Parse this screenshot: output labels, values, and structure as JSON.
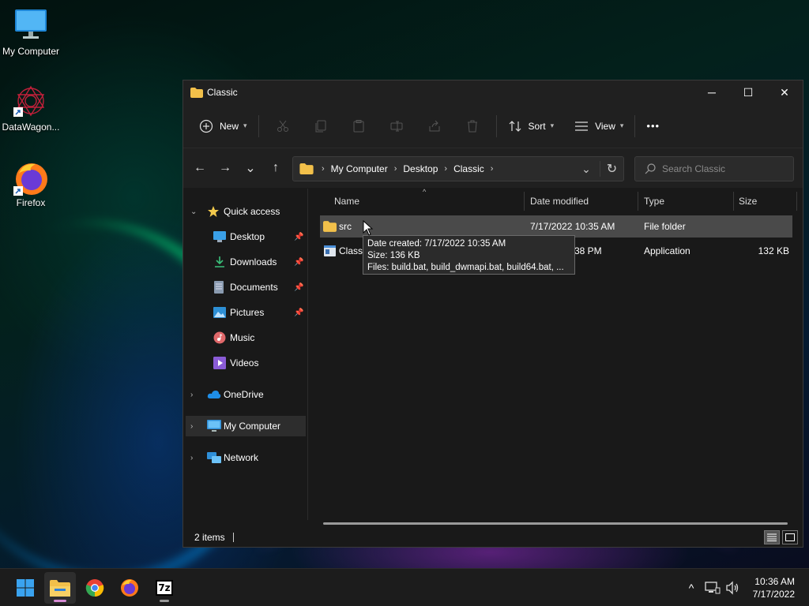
{
  "desktop": {
    "icons": [
      {
        "label": "My Computer",
        "icon": "monitor-icon"
      },
      {
        "label": "DataWagon...",
        "icon": "datawagon-icon"
      },
      {
        "label": "Firefox",
        "icon": "firefox-icon"
      }
    ]
  },
  "window": {
    "title": "Classic",
    "controls": {
      "minimize": "─",
      "maximize": "☐",
      "close": "✕"
    },
    "commandbar": {
      "new_label": "New",
      "sort_label": "Sort",
      "view_label": "View",
      "more_label": "•••",
      "disabled_icons": [
        "cut-icon",
        "copy-icon",
        "paste-icon",
        "rename-icon",
        "share-icon",
        "delete-icon"
      ]
    },
    "nav": {
      "back": "←",
      "forward": "→",
      "recent": "⌄",
      "up": "↑"
    },
    "address": {
      "crumbs": [
        "My Computer",
        "Desktop",
        "Classic"
      ],
      "refresh": "↻",
      "dropdown": "⌄"
    },
    "search": {
      "placeholder": "Search Classic"
    },
    "navpane": {
      "quick_access": "Quick access",
      "items": [
        {
          "label": "Desktop",
          "icon": "desktop-folder-icon",
          "pinned": true
        },
        {
          "label": "Downloads",
          "icon": "downloads-icon",
          "pinned": true
        },
        {
          "label": "Documents",
          "icon": "documents-icon",
          "pinned": true
        },
        {
          "label": "Pictures",
          "icon": "pictures-icon",
          "pinned": true
        },
        {
          "label": "Music",
          "icon": "music-icon",
          "pinned": false
        },
        {
          "label": "Videos",
          "icon": "videos-icon",
          "pinned": false
        }
      ],
      "onedrive": "OneDrive",
      "my_computer": "My Computer",
      "network": "Network"
    },
    "columns": {
      "name": "Name",
      "date": "Date modified",
      "type": "Type",
      "size": "Size"
    },
    "files": [
      {
        "name": "src",
        "date": "7/17/2022 10:35 AM",
        "type": "File folder",
        "size": ""
      },
      {
        "name": "Classi",
        "date": "38 PM",
        "type": "Application",
        "size": "132 KB"
      }
    ],
    "tooltip": {
      "line1": "Date created: 7/17/2022 10:35 AM",
      "line2": "Size: 136 KB",
      "line3": "Files: build.bat, build_dwmapi.bat, build64.bat, ..."
    },
    "status": {
      "count": "2 items"
    }
  },
  "taskbar": {
    "apps": [
      "start-icon",
      "file-explorer-icon",
      "chrome-icon",
      "firefox-icon",
      "7zip-icon"
    ],
    "sevenzip_label": "7z",
    "tray": {
      "chevron": "^"
    },
    "time": "10:36 AM",
    "date": "7/17/2022"
  },
  "colors": {
    "folder": "#f2c04a",
    "window_bg": "#191919",
    "chrome_bg": "#202020",
    "hover_row": "#4a4a4a",
    "accent_pink": "#d68ad4"
  }
}
